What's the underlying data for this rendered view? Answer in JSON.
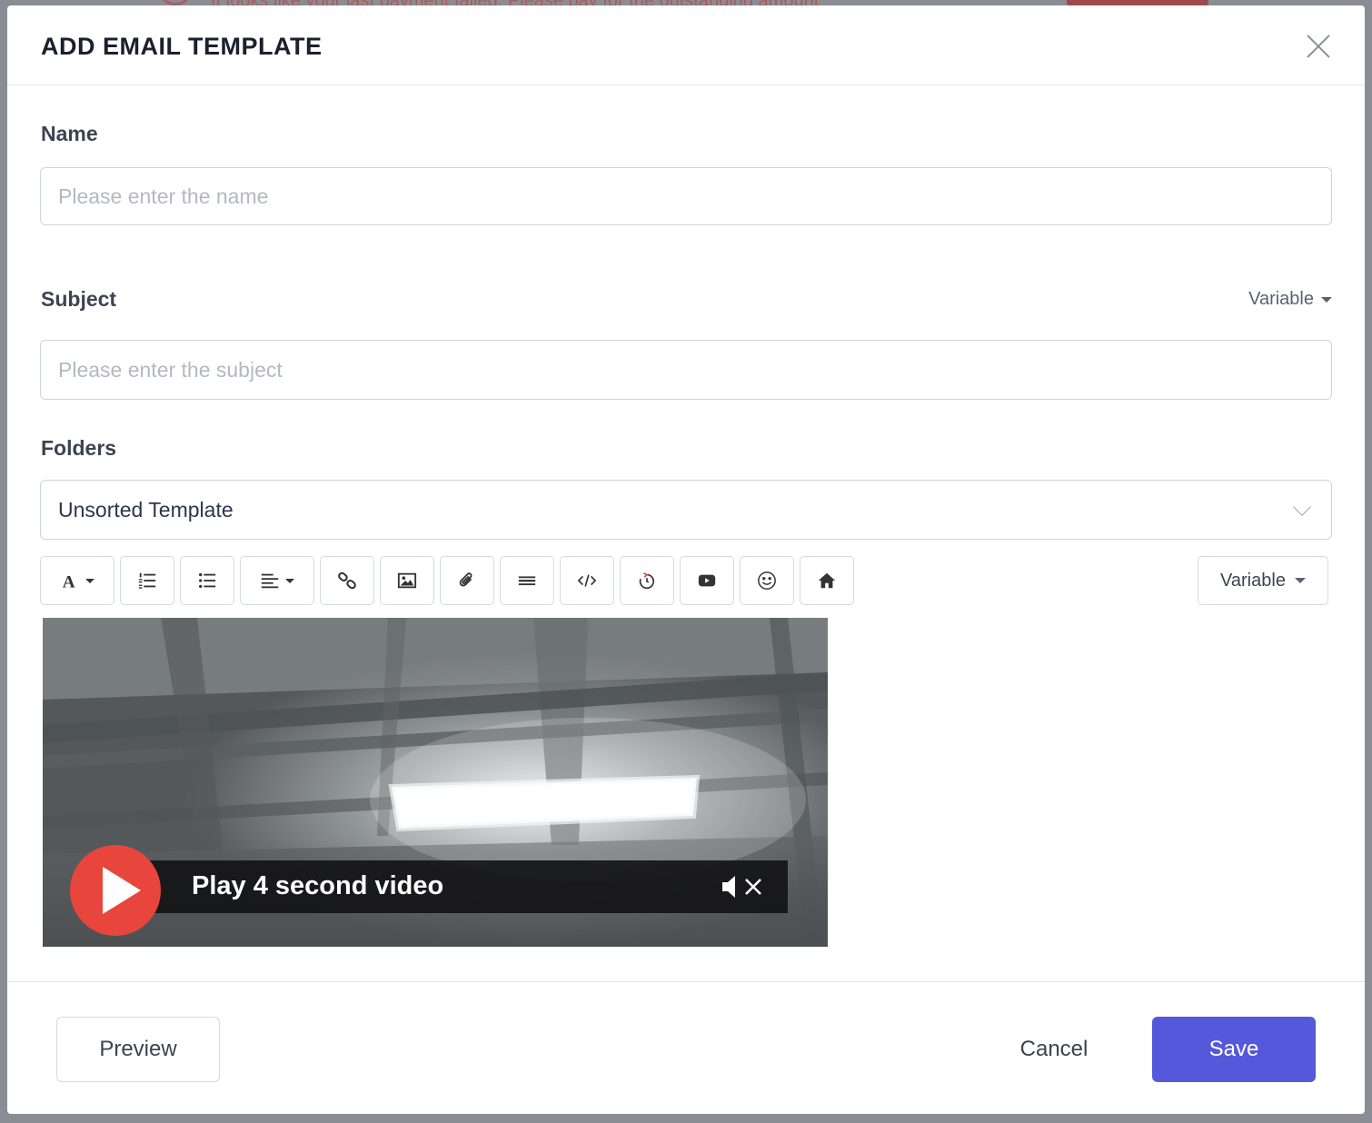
{
  "background": {
    "banner_text": "It looks like your last payment failed. Please pay for the outstanding amount"
  },
  "modal": {
    "title": "ADD EMAIL TEMPLATE",
    "name": {
      "label": "Name",
      "placeholder": "Please enter the name",
      "value": ""
    },
    "subject": {
      "label": "Subject",
      "placeholder": "Please enter the subject",
      "value": "",
      "variable_label": "Variable"
    },
    "folders": {
      "label": "Folders",
      "selected": "Unsorted Template"
    },
    "editor": {
      "toolbar": [
        {
          "name": "font-style",
          "icon": "font-icon"
        },
        {
          "name": "ordered-list",
          "icon": "ordered-list-icon"
        },
        {
          "name": "unordered-list",
          "icon": "unordered-list-icon"
        },
        {
          "name": "align",
          "icon": "align-left-icon"
        },
        {
          "name": "link",
          "icon": "link-icon"
        },
        {
          "name": "image",
          "icon": "image-icon"
        },
        {
          "name": "attachment",
          "icon": "paperclip-icon"
        },
        {
          "name": "horizontal-rule",
          "icon": "horizontal-rule-icon"
        },
        {
          "name": "code-view",
          "icon": "code-icon"
        },
        {
          "name": "timer",
          "icon": "timer-icon"
        },
        {
          "name": "video",
          "icon": "video-icon"
        },
        {
          "name": "emoji",
          "icon": "emoji-icon"
        },
        {
          "name": "home",
          "icon": "home-icon"
        }
      ],
      "variable_label": "Variable",
      "video": {
        "caption": "Play 4 second video"
      }
    },
    "footer": {
      "preview_label": "Preview",
      "cancel_label": "Cancel",
      "save_label": "Save"
    }
  },
  "colors": {
    "primary": "#5558da",
    "play_red": "#e8453c",
    "overlay": "#8a8d93"
  }
}
